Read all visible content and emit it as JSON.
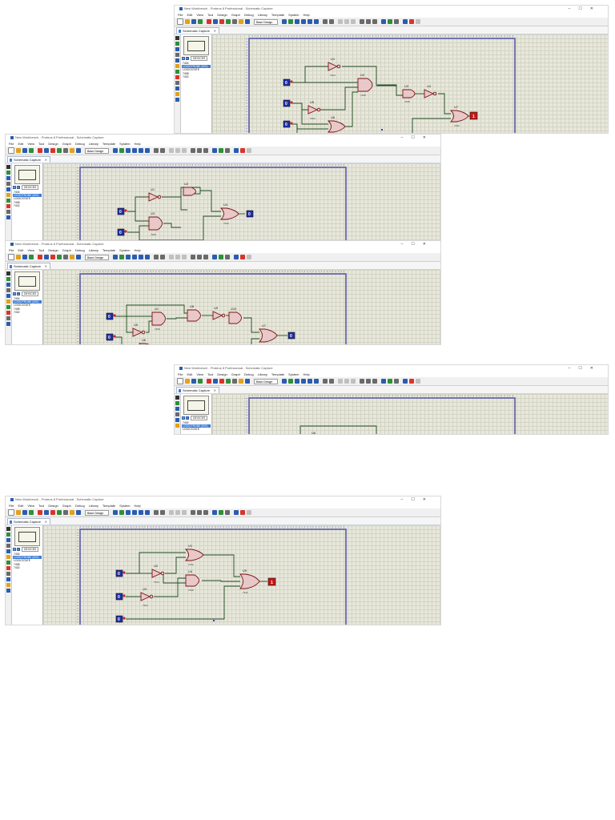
{
  "window": {
    "title": "New Workbench - Proteus 8 Professional - Schematic Capture",
    "controls": [
      "–",
      "☐",
      "✕"
    ]
  },
  "menu": [
    "File",
    "Edit",
    "View",
    "Tool",
    "Design",
    "Graph",
    "Debug",
    "Library",
    "Template",
    "System",
    "Help"
  ],
  "toolbar": {
    "design_combo": "Base Design",
    "accent_colors": [
      "#e2a21a",
      "#d9342b",
      "#2f8f3a",
      "#2a5db0",
      "#6a6a6a",
      "#c0c0c0"
    ]
  },
  "tab": {
    "label": "Schematic Capture",
    "close": "✕",
    "icon": "schematic-tab-icon"
  },
  "device_panel": {
    "p_label": "P",
    "l_label": "L",
    "header": "DEVICES",
    "items": [
      "7404",
      "LOGICPROBE (BIG)",
      "LOGICSTATE",
      "7408",
      "7432"
    ],
    "selected": 1
  },
  "logic_states": {
    "input": "0",
    "probe_low": "0",
    "probe_high": "1"
  },
  "gate_labels": {
    "u1": "U1",
    "u2": "U2",
    "u3": "U3",
    "u4": "U4",
    "u5": "U5",
    "u6": "U6",
    "u7": "U7",
    "u8": "U8",
    "u9": "U9",
    "u10": "U10",
    "part_not": "7404",
    "part_and": "7408",
    "part_or": "7432"
  }
}
